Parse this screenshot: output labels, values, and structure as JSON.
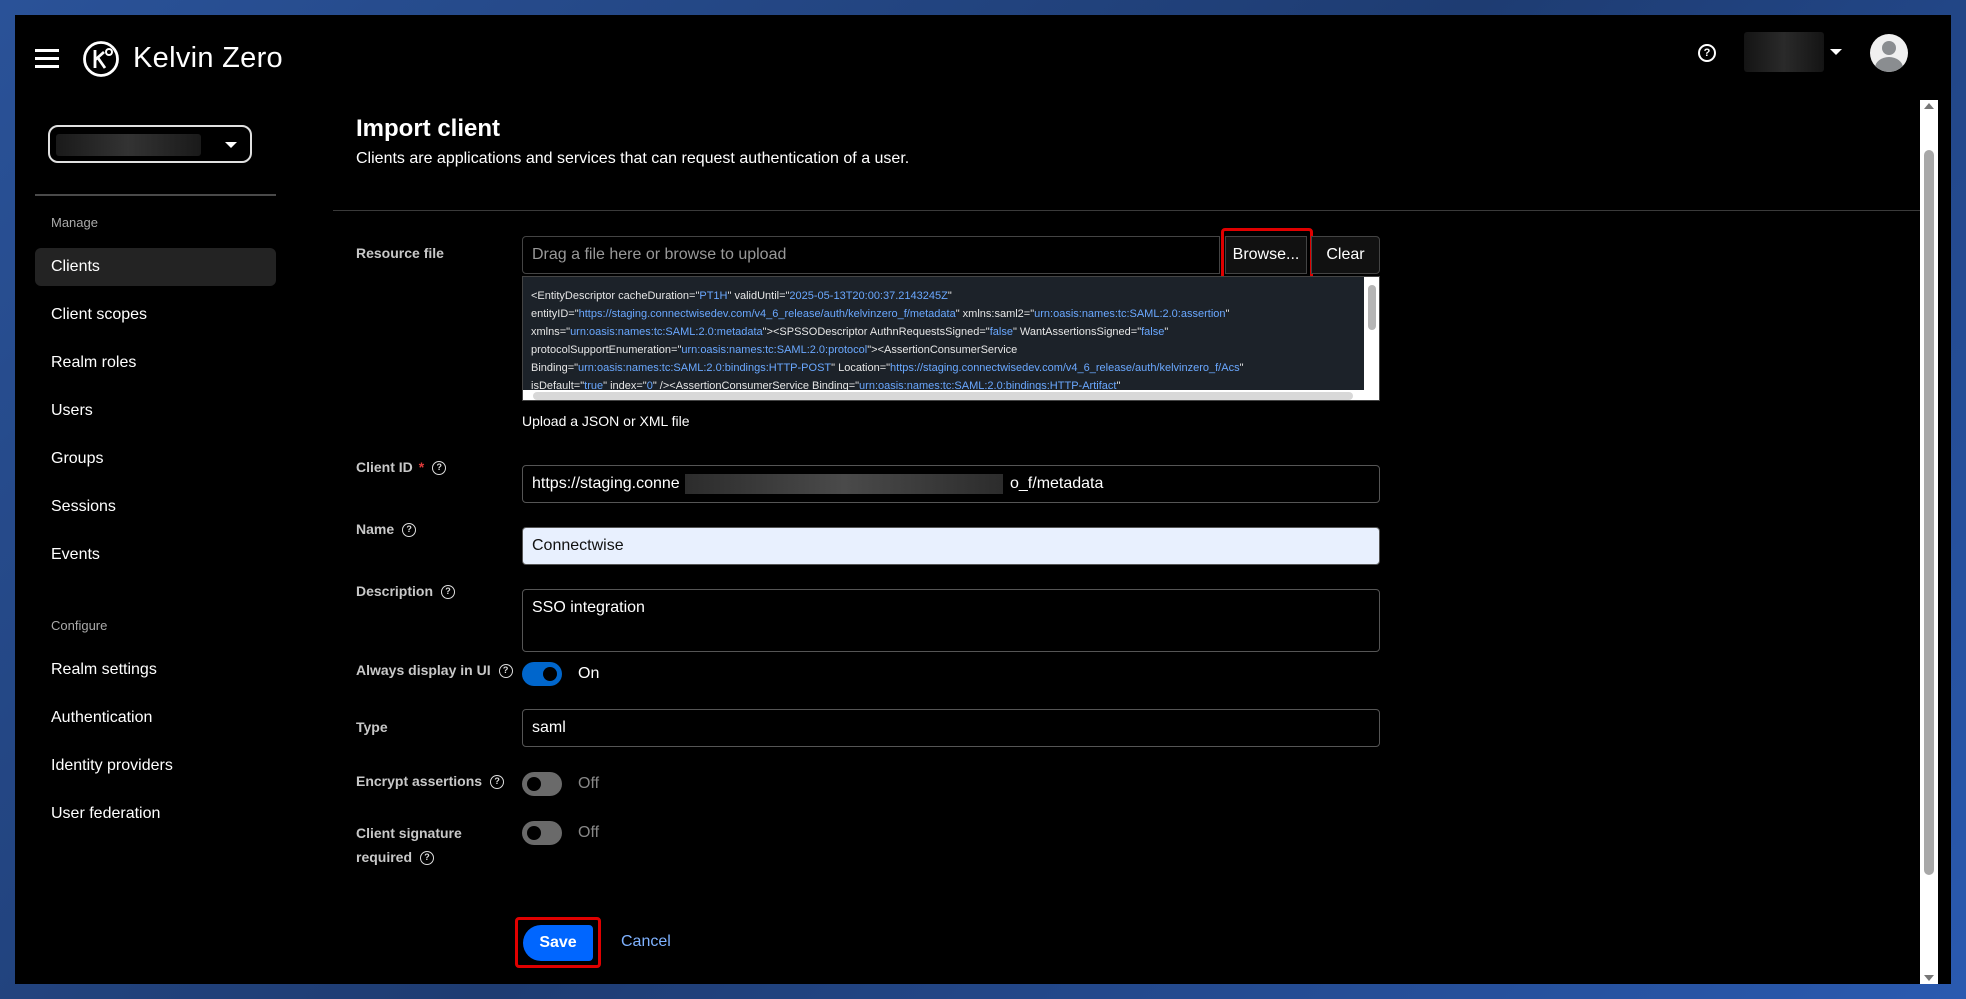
{
  "header": {
    "brand": "Kelvin Zero",
    "help_icon": "question-circle-icon",
    "avatar_icon": "user-avatar-icon",
    "menu_icon": "hamburger-menu-icon"
  },
  "sidebar": {
    "sections": [
      {
        "label": "Manage",
        "items": [
          "Clients",
          "Client scopes",
          "Realm roles",
          "Users",
          "Groups",
          "Sessions",
          "Events"
        ]
      },
      {
        "label": "Configure",
        "items": [
          "Realm settings",
          "Authentication",
          "Identity providers",
          "User federation"
        ]
      }
    ],
    "active_item": "Clients"
  },
  "page": {
    "title": "Import client",
    "subtitle": "Clients are applications and services that can request authentication of a user."
  },
  "form": {
    "resource_file": {
      "label": "Resource file",
      "placeholder": "Drag a file here or browse to upload",
      "browse_label": "Browse...",
      "clear_label": "Clear",
      "helper": "Upload a JSON or XML file"
    },
    "client_id": {
      "label": "Client ID",
      "required": "*",
      "value_start": "https://staging.conne",
      "value_end": "o_f/metadata"
    },
    "name": {
      "label": "Name",
      "value": "Connectwise"
    },
    "description": {
      "label": "Description",
      "value": "SSO integration"
    },
    "always_display": {
      "label": "Always display in UI",
      "state": "On"
    },
    "type": {
      "label": "Type",
      "value": "saml"
    },
    "encrypt_assertions": {
      "label": "Encrypt assertions",
      "state": "Off"
    },
    "client_signature": {
      "label_line1": "Client signature",
      "label_line2": "required",
      "state": "Off"
    },
    "save_label": "Save",
    "cancel_label": "Cancel"
  },
  "xml_lines": [
    [
      [
        "t",
        "<EntityDescriptor cacheDuration=\""
      ],
      [
        "s",
        "PT1H"
      ],
      [
        "t",
        "\" validUntil=\""
      ],
      [
        "s",
        "2025-05-13T20:00:37.2143245Z"
      ],
      [
        "t",
        "\""
      ]
    ],
    [
      [
        "t",
        "entityID=\""
      ],
      [
        "s",
        "https://staging.connectwisedev.com/v4_6_release/auth/kelvinzero_f/metadata"
      ],
      [
        "t",
        "\" xmlns:saml2=\""
      ],
      [
        "s",
        "urn:oasis:names:tc:SAML:2.0:assertion"
      ],
      [
        "t",
        "\""
      ]
    ],
    [
      [
        "t",
        "xmlns=\""
      ],
      [
        "s",
        "urn:oasis:names:tc:SAML:2.0:metadata"
      ],
      [
        "t",
        "\"><SPSSODescriptor AuthnRequestsSigned=\""
      ],
      [
        "s",
        "false"
      ],
      [
        "t",
        "\" WantAssertionsSigned=\""
      ],
      [
        "s",
        "false"
      ],
      [
        "t",
        "\""
      ]
    ],
    [
      [
        "t",
        "protocolSupportEnumeration=\""
      ],
      [
        "s",
        "urn:oasis:names:tc:SAML:2.0:protocol"
      ],
      [
        "t",
        "\"><AssertionConsumerService"
      ]
    ],
    [
      [
        "t",
        "Binding=\""
      ],
      [
        "s",
        "urn:oasis:names:tc:SAML:2.0:bindings:HTTP-POST"
      ],
      [
        "t",
        "\" Location=\""
      ],
      [
        "s",
        "https://staging.connectwisedev.com/v4_6_release/auth/kelvinzero_f/Acs"
      ],
      [
        "t",
        "\""
      ]
    ],
    [
      [
        "t",
        "isDefault=\""
      ],
      [
        "s",
        "true"
      ],
      [
        "t",
        "\" index=\""
      ],
      [
        "s",
        "0"
      ],
      [
        "t",
        "\" /><AssertionConsumerService Binding=\""
      ],
      [
        "s",
        "urn:oasis:names:tc:SAML:2.0:bindings:HTTP-Artifact"
      ],
      [
        "t",
        "\""
      ]
    ]
  ]
}
